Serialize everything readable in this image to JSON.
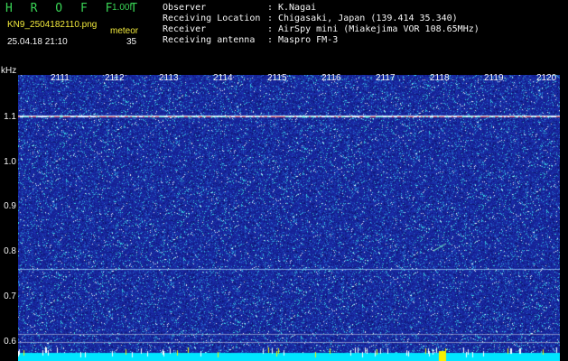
{
  "header": {
    "app_title": "H R O F F T",
    "version": "1.00f",
    "filename": "KN9_2504182110.png",
    "meteor_label": "meteor",
    "datetime": "25.04.18 21:10",
    "meteor_count": "35"
  },
  "info": [
    {
      "label": "Observer",
      "value": "K.Nagai"
    },
    {
      "label": "Receiving Location",
      "value": "Chigasaki, Japan (139.414 35.340)"
    },
    {
      "label": "Receiver",
      "value": "AirSpy mini (Miakejima VOR 108.65MHz)"
    },
    {
      "label": "Receiving antenna",
      "value": "Maspro FM-3"
    }
  ],
  "separator": ":",
  "axis": {
    "y_unit": "kHz",
    "y_labels": [
      "1.1",
      "1.0",
      "0.9",
      "0.8",
      "0.7",
      "0.6"
    ],
    "x_labels": [
      "2111",
      "2112",
      "2113",
      "2114",
      "2115",
      "2116",
      "2117",
      "2118",
      "2119",
      "2120"
    ]
  },
  "colors": {
    "background": "#000000",
    "spectrogram_base": "#1a2a9a",
    "header_green": "#39d455",
    "header_yellow": "#f2ea3c",
    "carrier_line": "#e0505a",
    "noise_floor": "#00e5ff"
  }
}
